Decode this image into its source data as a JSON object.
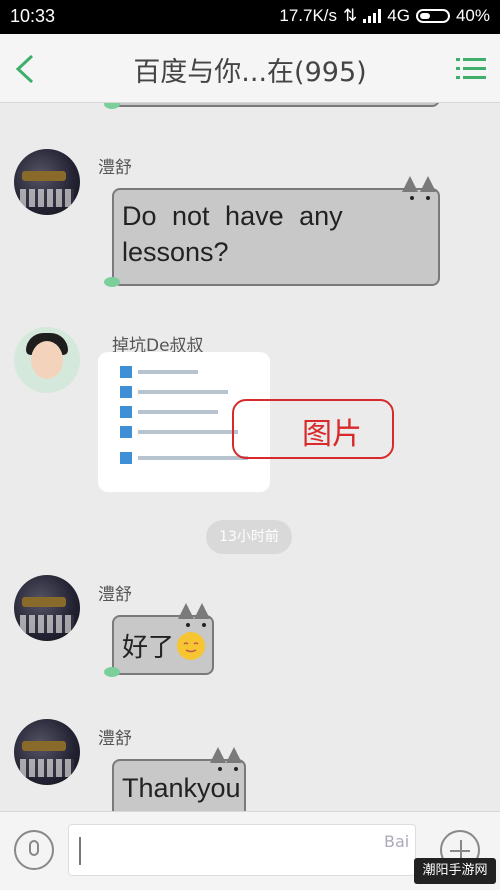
{
  "status_bar": {
    "time": "10:33",
    "speed": "17.7K/s",
    "network": "4G",
    "battery": "40%"
  },
  "header": {
    "title": "百度与你...在(995)"
  },
  "messages": [
    {
      "sender": "澧舒",
      "text": "Do not have any lessons?"
    },
    {
      "sender": "掉坑De叔叔",
      "type": "image"
    },
    {
      "sender": "澧舒",
      "text": "好了"
    },
    {
      "sender": "澧舒",
      "text": "Thankyou"
    }
  ],
  "annotation": {
    "label": "图片"
  },
  "timestamp": "13小时前",
  "watermarks": {
    "baidu": "Bai",
    "site": "潮阳手游网"
  }
}
